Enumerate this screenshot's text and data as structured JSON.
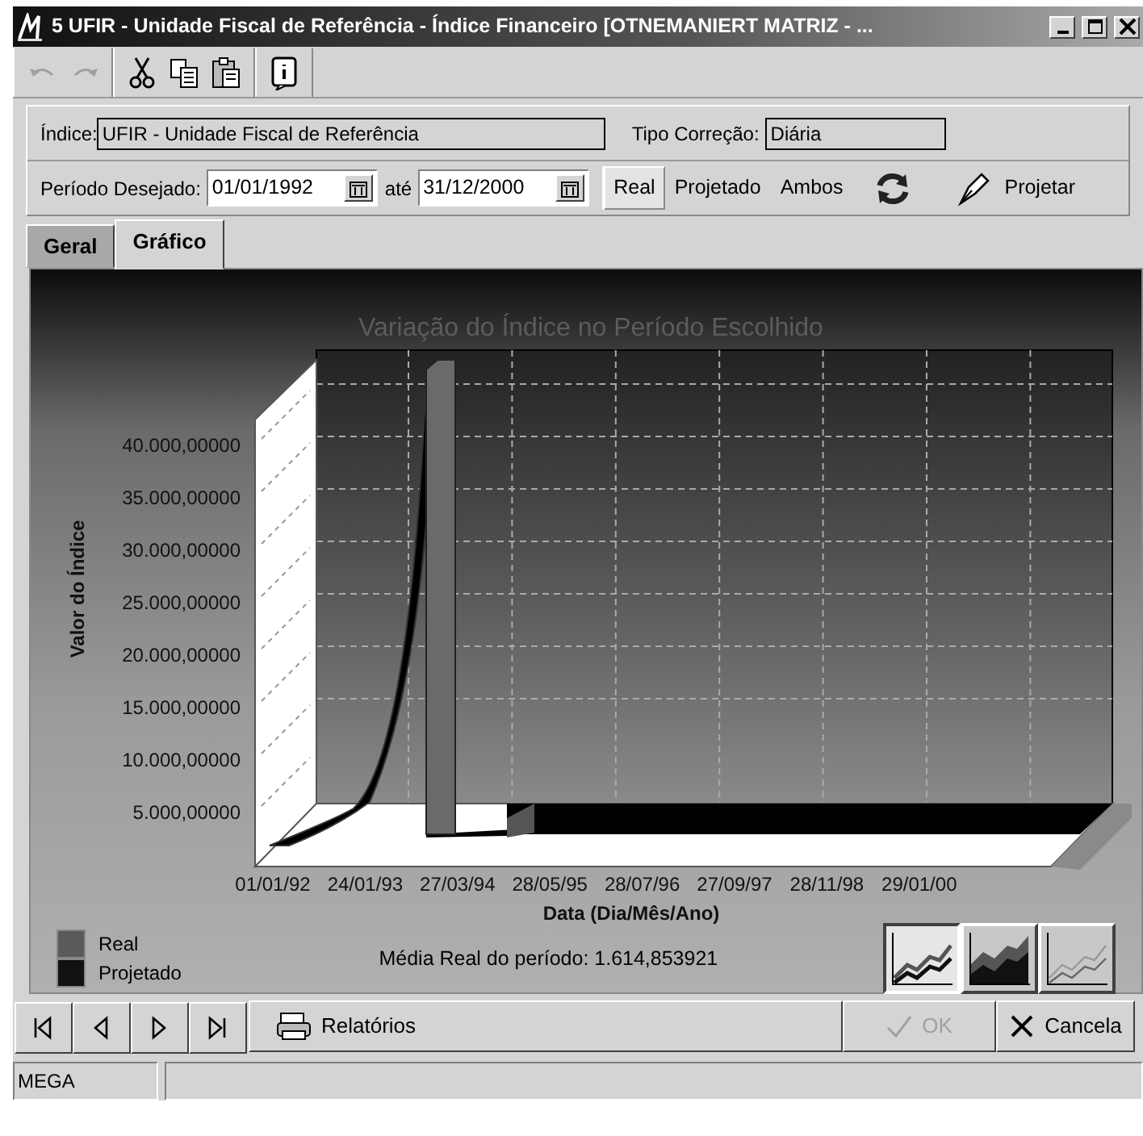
{
  "window": {
    "title": "5 UFIR - Unidade Fiscal de Referência -  Índice Financeiro [OTNEMANIERT MATRIZ - ..."
  },
  "toolbar": [
    {
      "kind": "undo",
      "disabled": true
    },
    {
      "kind": "redo",
      "disabled": true
    },
    {
      "kind": "cut",
      "disabled": false
    },
    {
      "kind": "copy",
      "disabled": false
    },
    {
      "kind": "paste",
      "disabled": false
    },
    {
      "kind": "info",
      "disabled": false
    }
  ],
  "index_row": {
    "index_label": "Índice:",
    "index_value": "UFIR - Unidade Fiscal de Referência",
    "correction_label": "Tipo Correção:",
    "correction_value": "Diária"
  },
  "period_row": {
    "label": "Período Desejado:",
    "start": "01/01/1992",
    "between": "até",
    "end": "31/12/2000",
    "options": [
      {
        "label": "Real",
        "selected": true
      },
      {
        "label": "Projetado",
        "selected": false
      },
      {
        "label": "Ambos",
        "selected": false
      }
    ],
    "project_button": "Projetar"
  },
  "tabs": [
    {
      "label": "Geral",
      "selected": false
    },
    {
      "label": "Gráfico",
      "selected": true
    }
  ],
  "chart": {
    "title": "Variação do Índice no Período Escolhido",
    "ylabel": "Valor do Índice",
    "yticks": [
      "40.000,00000",
      "35.000,00000",
      "30.000,00000",
      "25.000,00000",
      "20.000,00000",
      "15.000,00000",
      "10.000,00000",
      "5.000,00000"
    ],
    "xticks": [
      "01/01/92",
      "24/01/93",
      "27/03/94",
      "28/05/95",
      "28/07/96",
      "27/09/97",
      "28/11/98",
      "29/01/00"
    ],
    "xlabel": "Data (Dia/Mês/Ano)",
    "legend": [
      {
        "label": "Real",
        "color": "#5a5a5a"
      },
      {
        "label": "Projetado",
        "color": "#111111"
      }
    ],
    "average": "Média Real do período: 1.614,853921",
    "chart_types": [
      {
        "kind": "line",
        "selected": true
      },
      {
        "kind": "area",
        "selected": false
      },
      {
        "kind": "line",
        "selected": false
      }
    ]
  },
  "nav_buttons": [
    {
      "kind": "first"
    },
    {
      "kind": "prev"
    },
    {
      "kind": "next"
    },
    {
      "kind": "last"
    }
  ],
  "reports_button": "Relatórios",
  "ok_button": {
    "label": "OK",
    "disabled": true
  },
  "cancel_button": "Cancela",
  "status_bar": [
    "MEGA"
  ]
}
